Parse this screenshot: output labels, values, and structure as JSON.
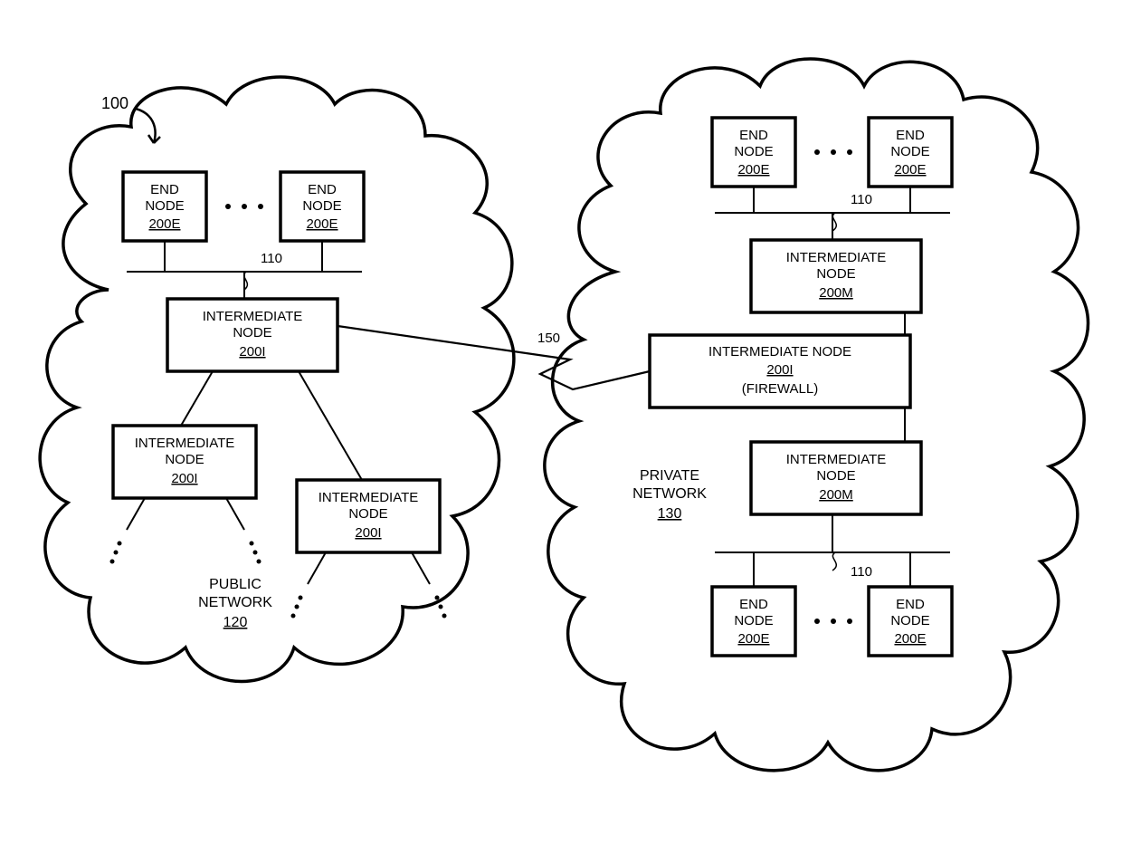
{
  "system_ref": "100",
  "public": {
    "label": "PUBLIC",
    "sub": "NETWORK",
    "id": "120",
    "end1": {
      "l1": "END",
      "l2": "NODE",
      "id": "200E"
    },
    "end2": {
      "l1": "END",
      "l2": "NODE",
      "id": "200E"
    },
    "bus_top": "110",
    "int_top": {
      "l1": "INTERMEDIATE",
      "l2": "NODE",
      "id": "200I"
    },
    "int_bl": {
      "l1": "INTERMEDIATE",
      "l2": "NODE",
      "id": "200I"
    },
    "int_br": {
      "l1": "INTERMEDIATE",
      "l2": "NODE",
      "id": "200I"
    }
  },
  "private": {
    "label": "PRIVATE",
    "sub": "NETWORK",
    "id": "130",
    "end1": {
      "l1": "END",
      "l2": "NODE",
      "id": "200E"
    },
    "end2": {
      "l1": "END",
      "l2": "NODE",
      "id": "200E"
    },
    "bus_top": "110",
    "int_top": {
      "l1": "INTERMEDIATE",
      "l2": "NODE",
      "id": "200M"
    },
    "firewall": {
      "l1": "INTERMEDIATE NODE",
      "id": "200I",
      "note": "(FIREWALL)"
    },
    "int_bot": {
      "l1": "INTERMEDIATE",
      "l2": "NODE",
      "id": "200M"
    },
    "end3": {
      "l1": "END",
      "l2": "NODE",
      "id": "200E"
    },
    "end4": {
      "l1": "END",
      "l2": "NODE",
      "id": "200E"
    },
    "bus_bot": "110"
  },
  "link": "150"
}
